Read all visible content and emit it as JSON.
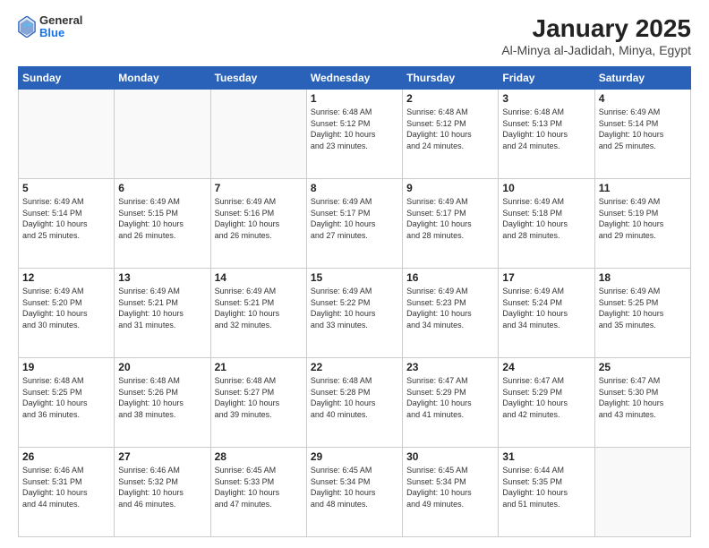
{
  "header": {
    "logo_line1": "General",
    "logo_line2": "Blue",
    "title": "January 2025",
    "subtitle": "Al-Minya al-Jadidah, Minya, Egypt"
  },
  "calendar": {
    "days_of_week": [
      "Sunday",
      "Monday",
      "Tuesday",
      "Wednesday",
      "Thursday",
      "Friday",
      "Saturday"
    ],
    "weeks": [
      [
        {
          "day": "",
          "info": ""
        },
        {
          "day": "",
          "info": ""
        },
        {
          "day": "",
          "info": ""
        },
        {
          "day": "1",
          "info": "Sunrise: 6:48 AM\nSunset: 5:12 PM\nDaylight: 10 hours\nand 23 minutes."
        },
        {
          "day": "2",
          "info": "Sunrise: 6:48 AM\nSunset: 5:12 PM\nDaylight: 10 hours\nand 24 minutes."
        },
        {
          "day": "3",
          "info": "Sunrise: 6:48 AM\nSunset: 5:13 PM\nDaylight: 10 hours\nand 24 minutes."
        },
        {
          "day": "4",
          "info": "Sunrise: 6:49 AM\nSunset: 5:14 PM\nDaylight: 10 hours\nand 25 minutes."
        }
      ],
      [
        {
          "day": "5",
          "info": "Sunrise: 6:49 AM\nSunset: 5:14 PM\nDaylight: 10 hours\nand 25 minutes."
        },
        {
          "day": "6",
          "info": "Sunrise: 6:49 AM\nSunset: 5:15 PM\nDaylight: 10 hours\nand 26 minutes."
        },
        {
          "day": "7",
          "info": "Sunrise: 6:49 AM\nSunset: 5:16 PM\nDaylight: 10 hours\nand 26 minutes."
        },
        {
          "day": "8",
          "info": "Sunrise: 6:49 AM\nSunset: 5:17 PM\nDaylight: 10 hours\nand 27 minutes."
        },
        {
          "day": "9",
          "info": "Sunrise: 6:49 AM\nSunset: 5:17 PM\nDaylight: 10 hours\nand 28 minutes."
        },
        {
          "day": "10",
          "info": "Sunrise: 6:49 AM\nSunset: 5:18 PM\nDaylight: 10 hours\nand 28 minutes."
        },
        {
          "day": "11",
          "info": "Sunrise: 6:49 AM\nSunset: 5:19 PM\nDaylight: 10 hours\nand 29 minutes."
        }
      ],
      [
        {
          "day": "12",
          "info": "Sunrise: 6:49 AM\nSunset: 5:20 PM\nDaylight: 10 hours\nand 30 minutes."
        },
        {
          "day": "13",
          "info": "Sunrise: 6:49 AM\nSunset: 5:21 PM\nDaylight: 10 hours\nand 31 minutes."
        },
        {
          "day": "14",
          "info": "Sunrise: 6:49 AM\nSunset: 5:21 PM\nDaylight: 10 hours\nand 32 minutes."
        },
        {
          "day": "15",
          "info": "Sunrise: 6:49 AM\nSunset: 5:22 PM\nDaylight: 10 hours\nand 33 minutes."
        },
        {
          "day": "16",
          "info": "Sunrise: 6:49 AM\nSunset: 5:23 PM\nDaylight: 10 hours\nand 34 minutes."
        },
        {
          "day": "17",
          "info": "Sunrise: 6:49 AM\nSunset: 5:24 PM\nDaylight: 10 hours\nand 34 minutes."
        },
        {
          "day": "18",
          "info": "Sunrise: 6:49 AM\nSunset: 5:25 PM\nDaylight: 10 hours\nand 35 minutes."
        }
      ],
      [
        {
          "day": "19",
          "info": "Sunrise: 6:48 AM\nSunset: 5:25 PM\nDaylight: 10 hours\nand 36 minutes."
        },
        {
          "day": "20",
          "info": "Sunrise: 6:48 AM\nSunset: 5:26 PM\nDaylight: 10 hours\nand 38 minutes."
        },
        {
          "day": "21",
          "info": "Sunrise: 6:48 AM\nSunset: 5:27 PM\nDaylight: 10 hours\nand 39 minutes."
        },
        {
          "day": "22",
          "info": "Sunrise: 6:48 AM\nSunset: 5:28 PM\nDaylight: 10 hours\nand 40 minutes."
        },
        {
          "day": "23",
          "info": "Sunrise: 6:47 AM\nSunset: 5:29 PM\nDaylight: 10 hours\nand 41 minutes."
        },
        {
          "day": "24",
          "info": "Sunrise: 6:47 AM\nSunset: 5:29 PM\nDaylight: 10 hours\nand 42 minutes."
        },
        {
          "day": "25",
          "info": "Sunrise: 6:47 AM\nSunset: 5:30 PM\nDaylight: 10 hours\nand 43 minutes."
        }
      ],
      [
        {
          "day": "26",
          "info": "Sunrise: 6:46 AM\nSunset: 5:31 PM\nDaylight: 10 hours\nand 44 minutes."
        },
        {
          "day": "27",
          "info": "Sunrise: 6:46 AM\nSunset: 5:32 PM\nDaylight: 10 hours\nand 46 minutes."
        },
        {
          "day": "28",
          "info": "Sunrise: 6:45 AM\nSunset: 5:33 PM\nDaylight: 10 hours\nand 47 minutes."
        },
        {
          "day": "29",
          "info": "Sunrise: 6:45 AM\nSunset: 5:34 PM\nDaylight: 10 hours\nand 48 minutes."
        },
        {
          "day": "30",
          "info": "Sunrise: 6:45 AM\nSunset: 5:34 PM\nDaylight: 10 hours\nand 49 minutes."
        },
        {
          "day": "31",
          "info": "Sunrise: 6:44 AM\nSunset: 5:35 PM\nDaylight: 10 hours\nand 51 minutes."
        },
        {
          "day": "",
          "info": ""
        }
      ]
    ]
  }
}
